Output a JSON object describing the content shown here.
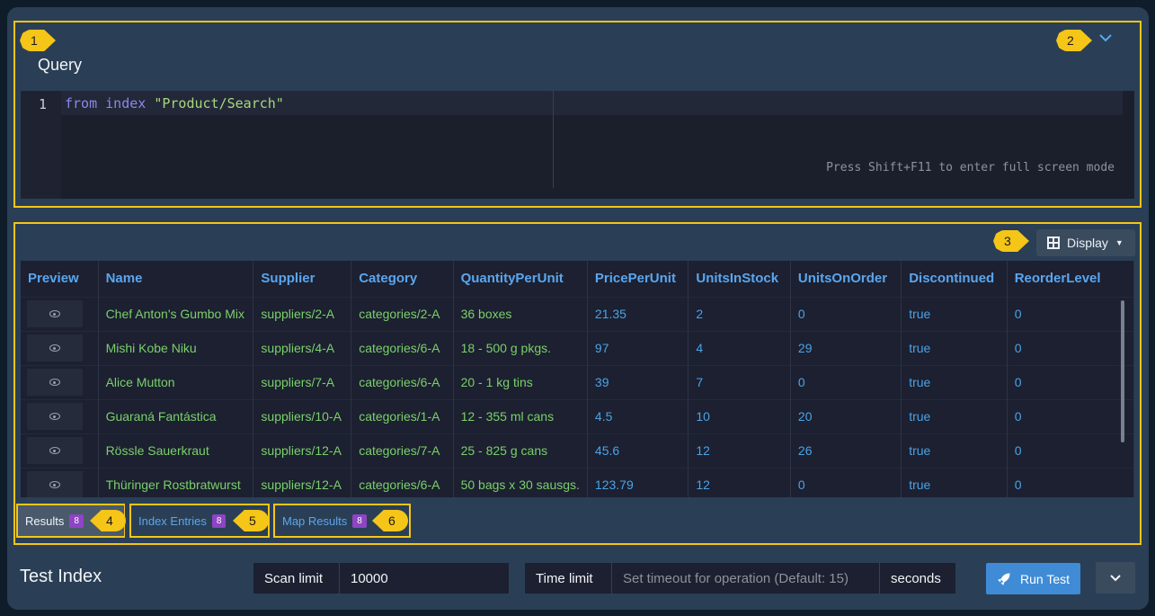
{
  "callouts": [
    "1",
    "2",
    "3",
    "4",
    "5",
    "6"
  ],
  "query": {
    "title": "Query",
    "line_number": "1",
    "code_kw1": "from",
    "code_kw2": "index",
    "code_str": "\"Product/Search\"",
    "hint": "Press Shift+F11 to enter full screen mode",
    "collapse_icon": "chevron-down-icon"
  },
  "results": {
    "display_label": "Display",
    "columns": [
      "Preview",
      "Name",
      "Supplier",
      "Category",
      "QuantityPerUnit",
      "PricePerUnit",
      "UnitsInStock",
      "UnitsOnOrder",
      "Discontinued",
      "ReorderLevel"
    ],
    "rows": [
      [
        "Chef Anton's Gumbo Mix",
        "suppliers/2-A",
        "categories/2-A",
        "36 boxes",
        "21.35",
        "2",
        "0",
        "true",
        "0"
      ],
      [
        "Mishi Kobe Niku",
        "suppliers/4-A",
        "categories/6-A",
        "18 - 500 g pkgs.",
        "97",
        "4",
        "29",
        "true",
        "0"
      ],
      [
        "Alice Mutton",
        "suppliers/7-A",
        "categories/6-A",
        "20 - 1 kg tins",
        "39",
        "7",
        "0",
        "true",
        "0"
      ],
      [
        "Guaraná Fantástica",
        "suppliers/10-A",
        "categories/1-A",
        "12 - 355 ml cans",
        "4.5",
        "10",
        "20",
        "true",
        "0"
      ],
      [
        "Rössle Sauerkraut",
        "suppliers/12-A",
        "categories/7-A",
        "25 - 825 g cans",
        "45.6",
        "12",
        "26",
        "true",
        "0"
      ],
      [
        "Thüringer Rostbratwurst",
        "suppliers/12-A",
        "categories/6-A",
        "50 bags x 30 sausgs.",
        "123.79",
        "12",
        "0",
        "true",
        "0"
      ]
    ],
    "tabs": [
      {
        "label": "Results",
        "count": "8"
      },
      {
        "label": "Index Entries",
        "count": "8"
      },
      {
        "label": "Map Results",
        "count": "8"
      }
    ]
  },
  "footer": {
    "title": "Test Index",
    "scan_limit_label": "Scan limit",
    "scan_limit_value": "10000",
    "time_limit_label": "Time limit",
    "time_limit_placeholder": "Set timeout for operation (Default: 15)",
    "time_unit": "seconds",
    "run_label": "Run Test"
  },
  "colors": {
    "accent": "#5aa6f0",
    "highlight": "#f5c518",
    "run_button": "#3f8bd6",
    "count_badge": "#8e44c4"
  }
}
